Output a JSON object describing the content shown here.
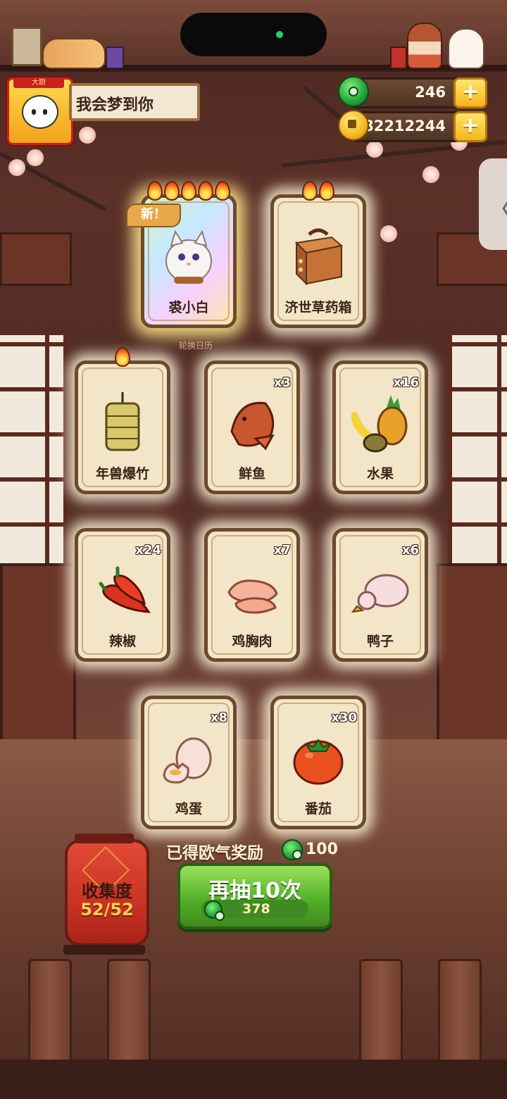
{
  "player": {
    "name": "我会梦到你",
    "avatar_badge": "大厨"
  },
  "currency": {
    "jade": "246",
    "coins": "82212244",
    "plus_label": "+"
  },
  "cards": [
    {
      "name": "裘小白",
      "qty": "",
      "flames": 5,
      "is_new": true,
      "new_label": "新！",
      "art": "cat-icon"
    },
    {
      "name": "济世草药箱",
      "qty": "",
      "flames": 2,
      "is_new": false,
      "art": "medicine-box-icon"
    },
    {
      "name": "年兽爆竹",
      "qty": "",
      "flames": 1,
      "is_new": false,
      "art": "firecracker-icon"
    },
    {
      "name": "鲜鱼",
      "qty": "x3",
      "flames": 0,
      "is_new": false,
      "art": "fish-icon"
    },
    {
      "name": "水果",
      "qty": "x16",
      "flames": 0,
      "is_new": false,
      "art": "fruit-icon"
    },
    {
      "name": "辣椒",
      "qty": "x24",
      "flames": 0,
      "is_new": false,
      "art": "chili-icon"
    },
    {
      "name": "鸡胸肉",
      "qty": "x7",
      "flames": 0,
      "is_new": false,
      "art": "chicken-breast-icon"
    },
    {
      "name": "鸭子",
      "qty": "x6",
      "flames": 0,
      "is_new": false,
      "art": "duck-icon"
    },
    {
      "name": "鸡蛋",
      "qty": "x8",
      "flames": 0,
      "is_new": false,
      "art": "egg-icon"
    },
    {
      "name": "番茄",
      "qty": "x30",
      "flames": 0,
      "is_new": false,
      "art": "tomato-icon"
    }
  ],
  "subtitle": "轮换日历",
  "reward": {
    "label": "已得欧气奖励",
    "amount": "100"
  },
  "draw_button": {
    "label": "再抽10次",
    "cost": "378"
  },
  "collection": {
    "label": "收集度",
    "value": "52/52"
  },
  "colors": {
    "accent_green": "#54b12a",
    "gold": "#f5b61c",
    "card_bg": "#f3e5c8",
    "lantern_red": "#c93322"
  }
}
